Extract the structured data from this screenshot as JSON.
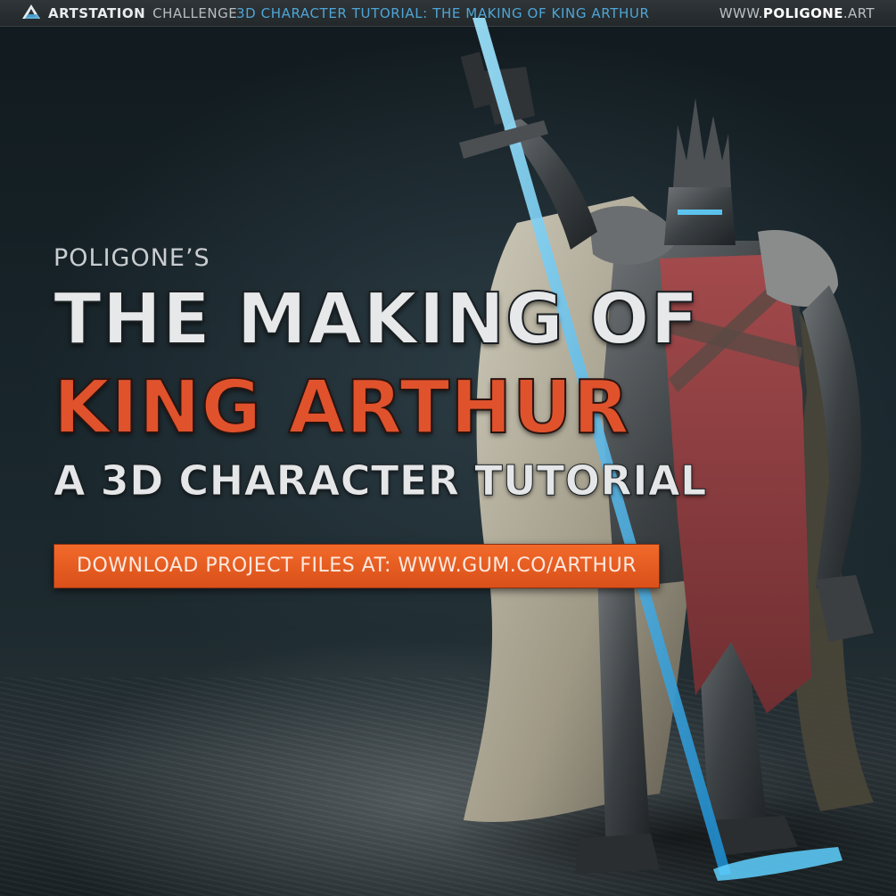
{
  "header": {
    "brand_strong": "ARTSTATION",
    "brand_light": "CHALLENGE",
    "title": "3D CHARACTER TUTORIAL: THE MAKING OF KING ARTHUR",
    "url_prefix": "WWW.",
    "url_strong": "POLIGONE",
    "url_suffix": ".ART",
    "logo_icon": "artstation-logo-icon"
  },
  "hero": {
    "presenter": "POLIGONE’S",
    "title_line_1": "THE MAKING OF",
    "title_line_2": "KING ARTHUR",
    "subtitle": "A 3D CHARACTER TUTORIAL",
    "cta_label": "DOWNLOAD PROJECT FILES AT: WWW.GUM.CO/ARTHUR"
  },
  "colors": {
    "accent_blue": "#4ea6d6",
    "accent_orange": "#e0522c",
    "button_orange": "#f26a2a",
    "background": "#0e1417"
  }
}
